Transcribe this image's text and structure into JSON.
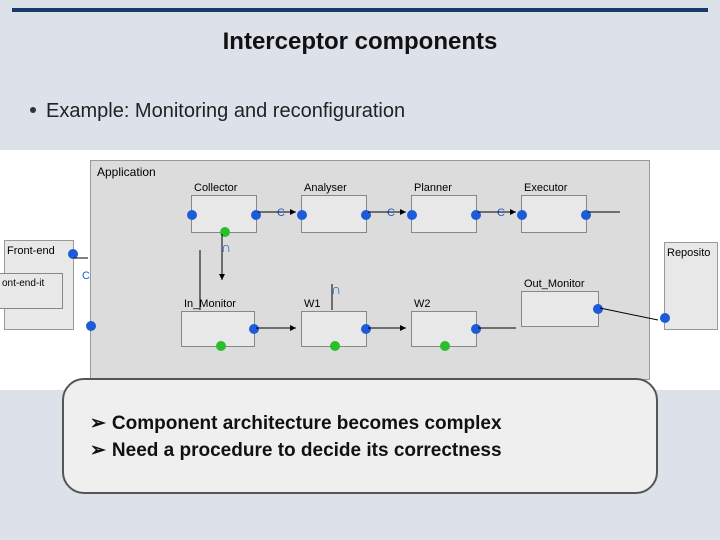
{
  "title": "Interceptor components",
  "bullet": "Example: Monitoring and reconfiguration",
  "diagram": {
    "app_label": "Application",
    "components": {
      "collector": "Collector",
      "analyser": "Analyser",
      "planner": "Planner",
      "executor": "Executor",
      "in_monitor": "In_Monitor",
      "out_monitor": "Out_Monitor",
      "w1": "W1",
      "w2": "W2",
      "front_end": "Front-end",
      "front_end_sub": "ont-end-it",
      "repository": "Reposito"
    },
    "connector_label": "C"
  },
  "callout": {
    "line1": "Component architecture becomes complex",
    "line2": "Need a procedure to decide its correctness",
    "marker": "➢"
  },
  "colors": {
    "accent_bar": "#1a3a6a",
    "port_blue": "#1e5bd8",
    "port_green": "#2abf2a"
  }
}
